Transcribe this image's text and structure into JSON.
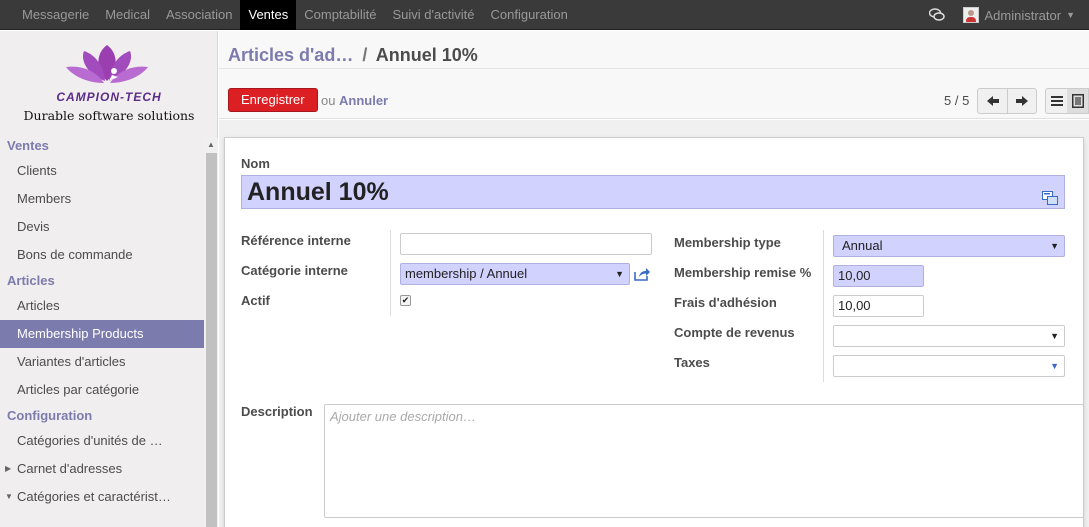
{
  "topbar": {
    "menu": [
      "Messagerie",
      "Medical",
      "Association",
      "Ventes",
      "Comptabilité",
      "Suivi d'activité",
      "Configuration"
    ],
    "active_index": 3,
    "user": "Administrator"
  },
  "sidebar": {
    "logo_text": "CAMPION-TECH",
    "logo_sub": "Durable software solutions",
    "sections": {
      "ventes": "Ventes",
      "articles": "Articles",
      "configuration": "Configuration"
    },
    "items": {
      "clients": "Clients",
      "members": "Members",
      "devis": "Devis",
      "bons": "Bons de commande",
      "articles": "Articles",
      "membership_products": "Membership Products",
      "variantes": "Variantes d'articles",
      "par_categorie": "Articles par catégorie",
      "categories_unites": "Catégories d'unités de …",
      "carnet": "Carnet d'adresses",
      "categories_caract": "Catégories et caractérist…"
    }
  },
  "header": {
    "breadcrumb_parent": "Articles d'ad…",
    "breadcrumb_sep": "/",
    "breadcrumb_current": "Annuel 10%",
    "save_label": "Enregistrer",
    "or_label": "ou",
    "cancel_label": "Annuler",
    "pager": "5 / 5"
  },
  "form": {
    "name_label": "Nom",
    "name_value": "Annuel 10%",
    "ref_label": "Référence interne",
    "ref_value": "",
    "categ_label": "Catégorie interne",
    "categ_value": "membership / Annuel",
    "actif_label": "Actif",
    "actif_checked": true,
    "mtype_label": "Membership type",
    "mtype_value": "Annual",
    "remise_label": "Membership remise %",
    "remise_value": "10,00",
    "frais_label": "Frais d'adhésion",
    "frais_value": "10,00",
    "compte_label": "Compte de revenus",
    "compte_value": "",
    "taxes_label": "Taxes",
    "taxes_value": "",
    "desc_label": "Description",
    "desc_placeholder": "Ajouter une description…"
  },
  "colors": {
    "topbar_bg": "#3a3a3a",
    "accent": "#7c7bad",
    "save_button": "#dc1f23",
    "required_field": "#d2d2ff"
  }
}
